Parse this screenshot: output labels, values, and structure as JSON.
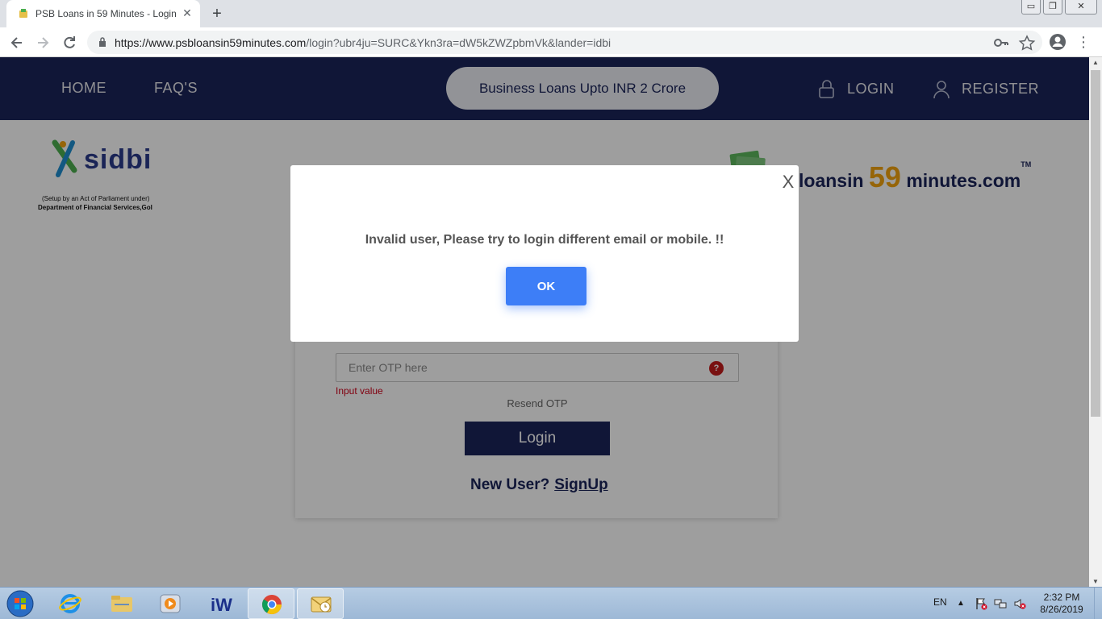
{
  "browser": {
    "tab_title": "PSB Loans in 59 Minutes - Login",
    "tab_close": "✕",
    "new_tab": "+",
    "url_host": "https://www.psbloansin59minutes.com",
    "url_path": "/login?ubr4ju=SURC&Ykn3ra=dW5kZWZpbmVk&lander=idbi",
    "back_icon": "arrow-left-icon",
    "forward_icon": "arrow-right-icon",
    "reload_icon": "reload-icon",
    "key_icon": "key-icon",
    "star_icon": "star-icon",
    "window_buttons": [
      "▭",
      "❐",
      "✕"
    ]
  },
  "header": {
    "nav": [
      "HOME",
      "FAQ'S"
    ],
    "promo": "Business Loans Upto INR 2 Crore",
    "login_label": "LOGIN",
    "register_label": "REGISTER",
    "bg_color": "#1b2459"
  },
  "logos": {
    "sidbi_name": "sidbi",
    "sidbi_line1": "(Setup by an Act of Parliament under)",
    "sidbi_line2": "Department of Financial Services,GoI",
    "psb_prefix": "loansin",
    "psb_number": "59",
    "psb_suffix": "minutes.com",
    "psb_tm": "TM"
  },
  "login_form": {
    "otp_placeholder": "Enter OTP here",
    "help_icon": "?",
    "error_text": "Input value",
    "resend_label": "Resend OTP",
    "login_button": "Login",
    "new_user_label": "New User?",
    "signup_link": "SignUp"
  },
  "modal": {
    "close_label": "X",
    "message": "Invalid user, Please try to login different email or mobile. !!",
    "ok_label": "OK",
    "accent_color": "#3d7ef7"
  },
  "taskbar": {
    "apps": [
      "internet-explorer-icon",
      "file-explorer-icon",
      "media-player-icon",
      "iw-app-icon",
      "chrome-icon",
      "outlook-icon"
    ],
    "iw_label": "iW",
    "language": "EN",
    "time": "2:32 PM",
    "date": "8/26/2019"
  }
}
